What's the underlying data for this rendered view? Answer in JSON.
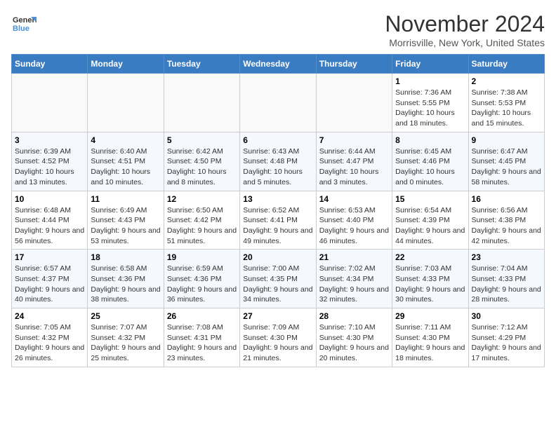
{
  "header": {
    "logo_general": "General",
    "logo_blue": "Blue",
    "month_title": "November 2024",
    "location": "Morrisville, New York, United States"
  },
  "days_of_week": [
    "Sunday",
    "Monday",
    "Tuesday",
    "Wednesday",
    "Thursday",
    "Friday",
    "Saturday"
  ],
  "weeks": [
    [
      {
        "day": "",
        "info": ""
      },
      {
        "day": "",
        "info": ""
      },
      {
        "day": "",
        "info": ""
      },
      {
        "day": "",
        "info": ""
      },
      {
        "day": "",
        "info": ""
      },
      {
        "day": "1",
        "info": "Sunrise: 7:36 AM\nSunset: 5:55 PM\nDaylight: 10 hours and 18 minutes."
      },
      {
        "day": "2",
        "info": "Sunrise: 7:38 AM\nSunset: 5:53 PM\nDaylight: 10 hours and 15 minutes."
      }
    ],
    [
      {
        "day": "3",
        "info": "Sunrise: 6:39 AM\nSunset: 4:52 PM\nDaylight: 10 hours and 13 minutes."
      },
      {
        "day": "4",
        "info": "Sunrise: 6:40 AM\nSunset: 4:51 PM\nDaylight: 10 hours and 10 minutes."
      },
      {
        "day": "5",
        "info": "Sunrise: 6:42 AM\nSunset: 4:50 PM\nDaylight: 10 hours and 8 minutes."
      },
      {
        "day": "6",
        "info": "Sunrise: 6:43 AM\nSunset: 4:48 PM\nDaylight: 10 hours and 5 minutes."
      },
      {
        "day": "7",
        "info": "Sunrise: 6:44 AM\nSunset: 4:47 PM\nDaylight: 10 hours and 3 minutes."
      },
      {
        "day": "8",
        "info": "Sunrise: 6:45 AM\nSunset: 4:46 PM\nDaylight: 10 hours and 0 minutes."
      },
      {
        "day": "9",
        "info": "Sunrise: 6:47 AM\nSunset: 4:45 PM\nDaylight: 9 hours and 58 minutes."
      }
    ],
    [
      {
        "day": "10",
        "info": "Sunrise: 6:48 AM\nSunset: 4:44 PM\nDaylight: 9 hours and 56 minutes."
      },
      {
        "day": "11",
        "info": "Sunrise: 6:49 AM\nSunset: 4:43 PM\nDaylight: 9 hours and 53 minutes."
      },
      {
        "day": "12",
        "info": "Sunrise: 6:50 AM\nSunset: 4:42 PM\nDaylight: 9 hours and 51 minutes."
      },
      {
        "day": "13",
        "info": "Sunrise: 6:52 AM\nSunset: 4:41 PM\nDaylight: 9 hours and 49 minutes."
      },
      {
        "day": "14",
        "info": "Sunrise: 6:53 AM\nSunset: 4:40 PM\nDaylight: 9 hours and 46 minutes."
      },
      {
        "day": "15",
        "info": "Sunrise: 6:54 AM\nSunset: 4:39 PM\nDaylight: 9 hours and 44 minutes."
      },
      {
        "day": "16",
        "info": "Sunrise: 6:56 AM\nSunset: 4:38 PM\nDaylight: 9 hours and 42 minutes."
      }
    ],
    [
      {
        "day": "17",
        "info": "Sunrise: 6:57 AM\nSunset: 4:37 PM\nDaylight: 9 hours and 40 minutes."
      },
      {
        "day": "18",
        "info": "Sunrise: 6:58 AM\nSunset: 4:36 PM\nDaylight: 9 hours and 38 minutes."
      },
      {
        "day": "19",
        "info": "Sunrise: 6:59 AM\nSunset: 4:36 PM\nDaylight: 9 hours and 36 minutes."
      },
      {
        "day": "20",
        "info": "Sunrise: 7:00 AM\nSunset: 4:35 PM\nDaylight: 9 hours and 34 minutes."
      },
      {
        "day": "21",
        "info": "Sunrise: 7:02 AM\nSunset: 4:34 PM\nDaylight: 9 hours and 32 minutes."
      },
      {
        "day": "22",
        "info": "Sunrise: 7:03 AM\nSunset: 4:33 PM\nDaylight: 9 hours and 30 minutes."
      },
      {
        "day": "23",
        "info": "Sunrise: 7:04 AM\nSunset: 4:33 PM\nDaylight: 9 hours and 28 minutes."
      }
    ],
    [
      {
        "day": "24",
        "info": "Sunrise: 7:05 AM\nSunset: 4:32 PM\nDaylight: 9 hours and 26 minutes."
      },
      {
        "day": "25",
        "info": "Sunrise: 7:07 AM\nSunset: 4:32 PM\nDaylight: 9 hours and 25 minutes."
      },
      {
        "day": "26",
        "info": "Sunrise: 7:08 AM\nSunset: 4:31 PM\nDaylight: 9 hours and 23 minutes."
      },
      {
        "day": "27",
        "info": "Sunrise: 7:09 AM\nSunset: 4:30 PM\nDaylight: 9 hours and 21 minutes."
      },
      {
        "day": "28",
        "info": "Sunrise: 7:10 AM\nSunset: 4:30 PM\nDaylight: 9 hours and 20 minutes."
      },
      {
        "day": "29",
        "info": "Sunrise: 7:11 AM\nSunset: 4:30 PM\nDaylight: 9 hours and 18 minutes."
      },
      {
        "day": "30",
        "info": "Sunrise: 7:12 AM\nSunset: 4:29 PM\nDaylight: 9 hours and 17 minutes."
      }
    ]
  ]
}
